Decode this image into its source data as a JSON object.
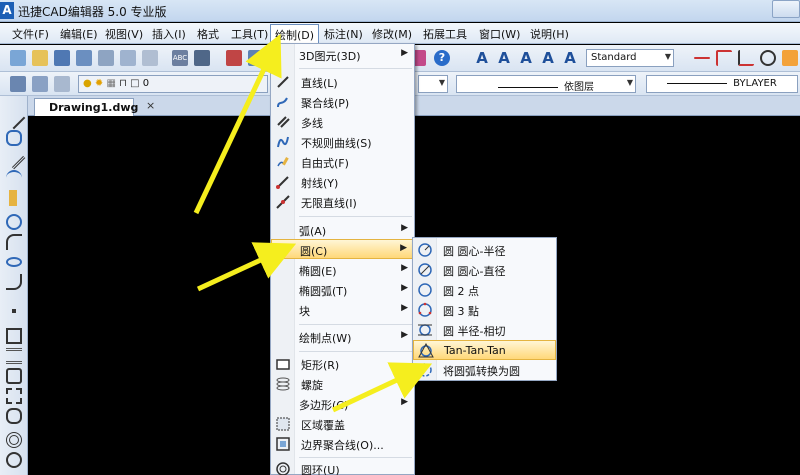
{
  "window": {
    "title": "迅捷CAD编辑器 5.0 专业版"
  },
  "menubar": {
    "items": [
      "文件(F)",
      "编辑(E)",
      "视图(V)",
      "插入(I)",
      "工具(T)",
      "绘制(D)",
      "标注(N)",
      "修改(M)",
      "拓展工具",
      "窗口(W)",
      "说明(H)"
    ]
  },
  "toolbar": {
    "text_style": "Standard",
    "layer_value": "0",
    "linetype": "依图层",
    "lineweight": "BYLAYER"
  },
  "document": {
    "tab_title": "Drawing1.dwg",
    "close_glyph": "×"
  },
  "draw_menu": {
    "items": [
      {
        "label": "3D图元(3D)",
        "submenu": true
      },
      {
        "label": "直线(L)"
      },
      {
        "label": "聚合线(P)"
      },
      {
        "label": "多线"
      },
      {
        "label": "不规则曲线(S)"
      },
      {
        "label": "自由式(F)"
      },
      {
        "label": "射线(Y)"
      },
      {
        "label": "无限直线(I)"
      },
      {
        "label": "弧(A)",
        "submenu": true
      },
      {
        "label": "圆(C)",
        "submenu": true,
        "highlighted": true
      },
      {
        "label": "椭圆(E)",
        "submenu": true
      },
      {
        "label": "椭圆弧(T)",
        "submenu": true
      },
      {
        "label": "块",
        "submenu": true
      },
      {
        "label": "绘制点(W)",
        "submenu": true
      },
      {
        "label": "矩形(R)"
      },
      {
        "label": "螺旋"
      },
      {
        "label": "多边形(C)",
        "submenu": true
      },
      {
        "label": "区域覆盖"
      },
      {
        "label": "边界聚合线(O)..."
      },
      {
        "label": "圆环(U)"
      }
    ]
  },
  "circle_submenu": {
    "items": [
      {
        "label": "圆 圆心-半径"
      },
      {
        "label": "圆 圆心-直径"
      },
      {
        "label": "圆 2 点"
      },
      {
        "label": "圆 3 點"
      },
      {
        "label": "圆 半径-相切"
      },
      {
        "label": "Tan-Tan-Tan",
        "highlighted": true
      },
      {
        "label": "将圆弧转换为圆"
      }
    ]
  },
  "colors": {
    "canvas": "#000000",
    "highlight": "#ffd879",
    "arrow": "#f5ee1e"
  }
}
